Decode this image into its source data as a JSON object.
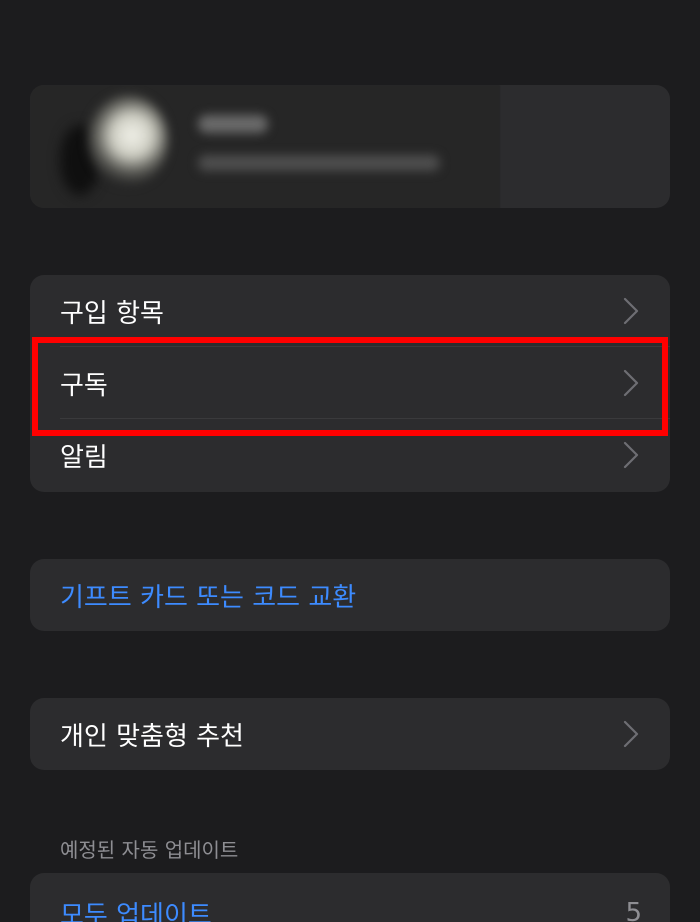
{
  "menu": {
    "items": [
      {
        "label": "구입 항목"
      },
      {
        "label": "구독"
      },
      {
        "label": "알림"
      }
    ]
  },
  "gift": {
    "label": "기프트 카드 또는 코드 교환"
  },
  "recommendations": {
    "label": "개인 맞춤형 추천"
  },
  "updates": {
    "section_header": "예정된 자동 업데이트",
    "update_all_label": "모두 업데이트",
    "count": "5"
  },
  "colors": {
    "background": "#1c1c1e",
    "card": "#2c2c2e",
    "accent_link": "#3d8bff",
    "highlight": "#ff0000"
  },
  "icons": {
    "chevron": "chevron-right-icon"
  }
}
